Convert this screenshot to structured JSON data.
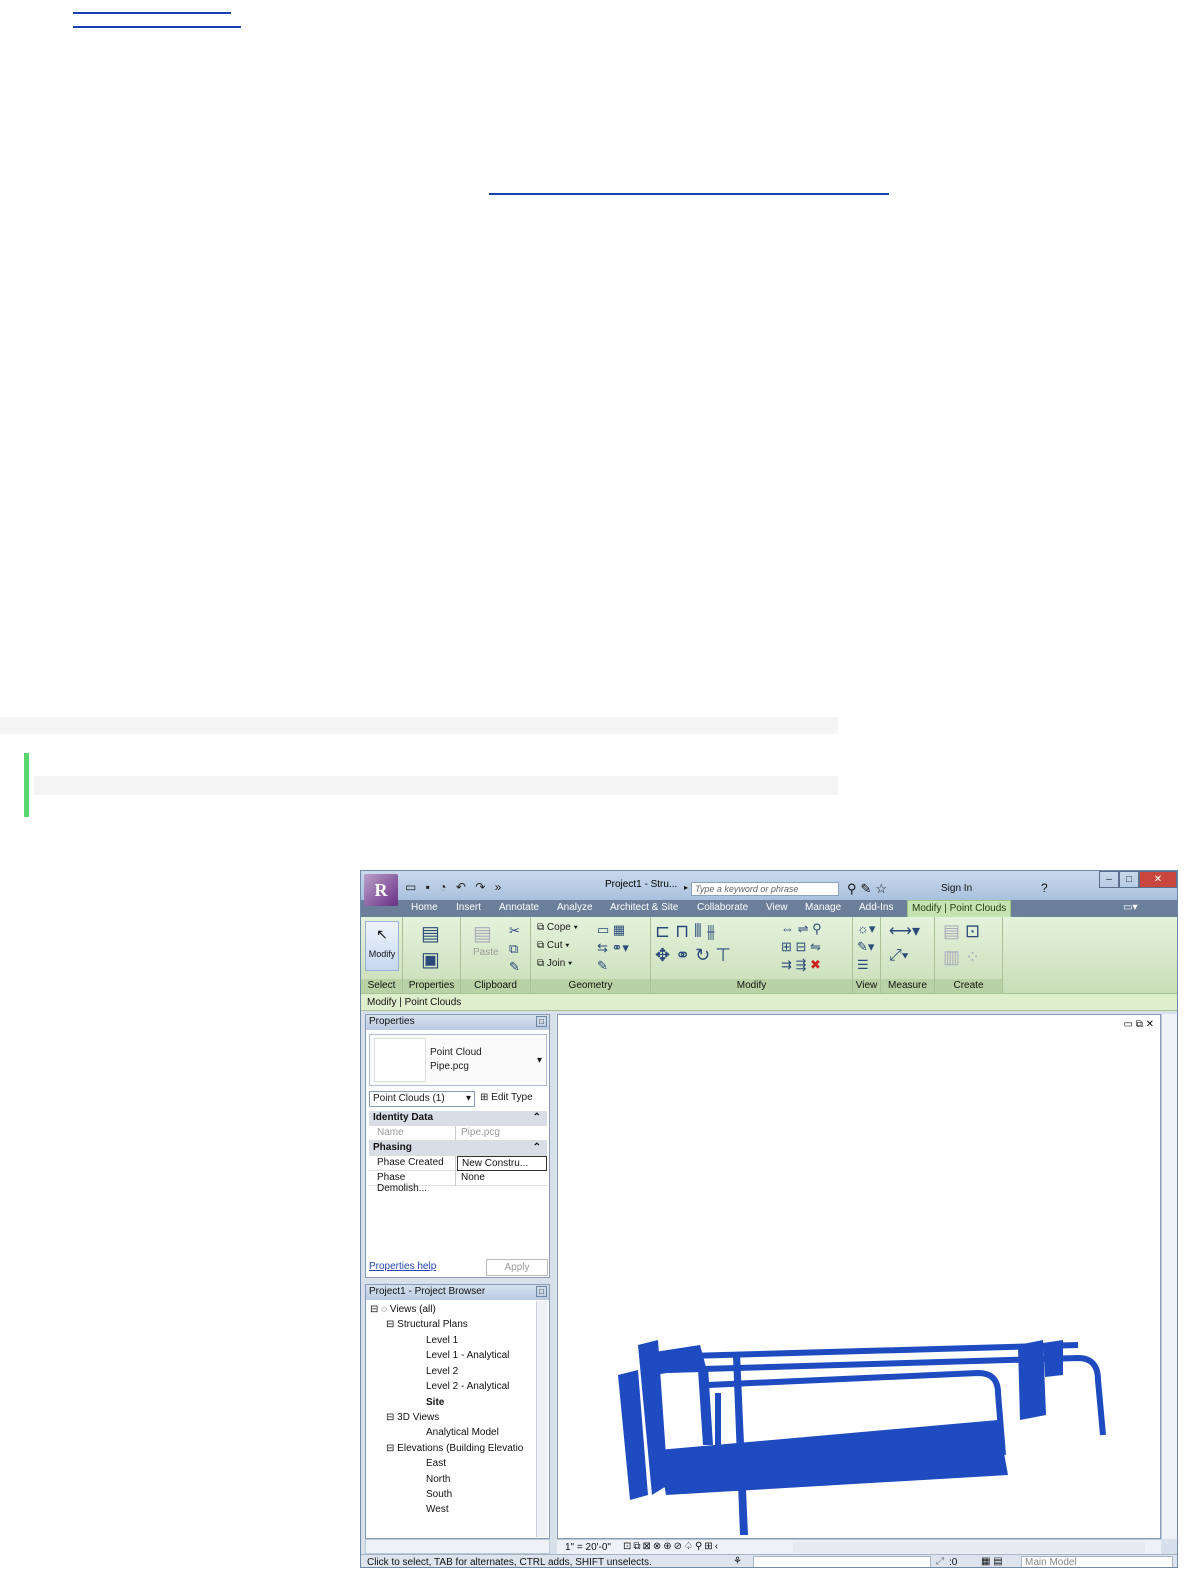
{
  "window": {
    "logo": "R",
    "title": "Project1 - Stru...",
    "search_placeholder": "Type a keyword or phrase",
    "sign_in": "Sign In",
    "help": "?"
  },
  "tabs": [
    "Home",
    "Insert",
    "Annotate",
    "Analyze",
    "Architect & Site",
    "Collaborate",
    "View",
    "Manage",
    "Add-Ins",
    "Modify | Point Clouds"
  ],
  "ribbon": {
    "modify_label": "Modify",
    "paste_label": "Paste",
    "cope": "Cope",
    "cut": "Cut",
    "join": "Join",
    "panels": [
      "Select",
      "Properties",
      "Clipboard",
      "Geometry",
      "Modify",
      "View",
      "Measure",
      "Create"
    ]
  },
  "context_bar": "Modify | Point Clouds",
  "properties": {
    "title": "Properties",
    "type_name": "Point Cloud",
    "type_sub": "Pipe.pcg",
    "selector": "Point Clouds (1)",
    "edit_type": "Edit Type",
    "sections": [
      {
        "name": "Identity Data",
        "rows": [
          {
            "k": "Name",
            "v": "Pipe.pcg"
          }
        ]
      },
      {
        "name": "Phasing",
        "rows": [
          {
            "k": "Phase Created",
            "v": "New Constru..."
          },
          {
            "k": "Phase Demolish...",
            "v": "None"
          }
        ]
      }
    ],
    "help_link": "Properties help",
    "apply": "Apply"
  },
  "browser": {
    "title": "Project1 - Project Browser",
    "items": [
      "Views (all)",
      "Structural Plans",
      "Level 1",
      "Level 1 - Analytical",
      "Level 2",
      "Level 2 - Analytical",
      "Site",
      "3D Views",
      "Analytical Model",
      "Elevations (Building Elevatio",
      "East",
      "North",
      "South",
      "West"
    ]
  },
  "view_control": {
    "scale": "1\" = 20'-0\""
  },
  "status": {
    "text": "Click to select, TAB for alternates, CTRL adds, SHIFT unselects.",
    "zero": ":0",
    "model": "Main Model"
  },
  "accent": "#1f4bc0"
}
